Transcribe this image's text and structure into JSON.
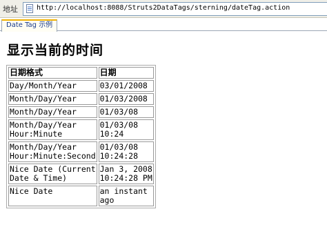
{
  "browser": {
    "address_label": "地址",
    "url": "http://localhost:8088/Struts2DataTags/sterning/dateTag.action",
    "tab_label": "Date Tag 示例"
  },
  "page": {
    "title": "显示当前的时间",
    "table": {
      "headers": [
        "日期格式",
        "日期"
      ],
      "rows": [
        {
          "format": "Day/Month/Year",
          "date": "03/01/2008"
        },
        {
          "format": "Month/Day/Year",
          "date": "01/03/2008"
        },
        {
          "format": "Month/Day/Year",
          "date": "01/03/08"
        },
        {
          "format": "Month/Day/Year\nHour:Minute",
          "date": "01/03/08\n10:24"
        },
        {
          "format": "Month/Day/Year\nHour:Minute:Second",
          "date": "01/03/08\n10:24:28"
        },
        {
          "format": "Nice Date (Current\nDate & Time)",
          "date": "Jan 3, 2008\n10:24:28 PM"
        },
        {
          "format": "Nice Date",
          "date": "an instant\nago"
        }
      ]
    }
  }
}
